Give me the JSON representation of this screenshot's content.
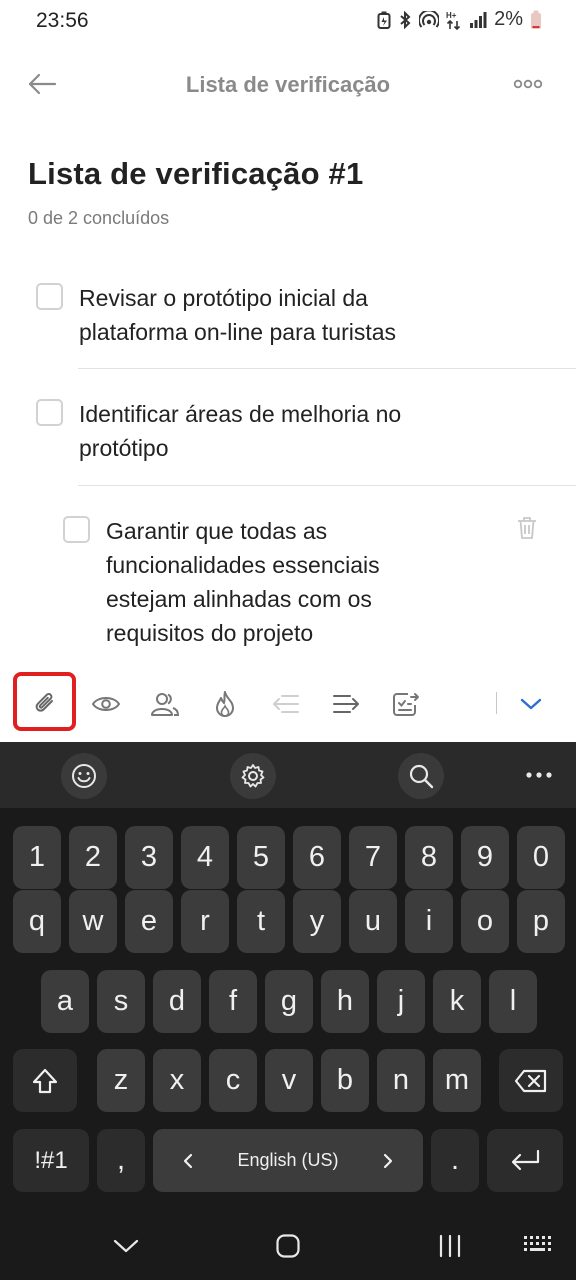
{
  "status_bar": {
    "time": "23:56",
    "battery_text": "2%",
    "icons": [
      "battery-saver-icon",
      "bluetooth-icon",
      "hotspot-icon",
      "data-arrows-icon",
      "signal-icon",
      "battery-icon"
    ]
  },
  "header": {
    "title": "Lista de verificação"
  },
  "checklist": {
    "title": "Lista de verificação #1",
    "progress": "0 de 2 concluídos",
    "items": [
      {
        "text": "Revisar o protótipo inicial da plataforma on-line para turistas",
        "checked": false
      },
      {
        "text": "Identificar áreas de melhoria no protótipo",
        "checked": false
      },
      {
        "text": "Garantir que todas as funcionalidades essenciais estejam alinhadas com os requisitos do projeto",
        "checked": false
      }
    ]
  },
  "toolbar": {
    "icons": [
      "paperclip-icon",
      "eye-icon",
      "people-icon",
      "flame-icon",
      "outdent-icon",
      "indent-icon",
      "checklist-convert-icon",
      "chevron-down-icon"
    ],
    "highlight_color": "#e02020",
    "accent_color": "#2a6fd6"
  },
  "keyboard": {
    "row_numbers": [
      "1",
      "2",
      "3",
      "4",
      "5",
      "6",
      "7",
      "8",
      "9",
      "0"
    ],
    "row1": [
      "q",
      "w",
      "e",
      "r",
      "t",
      "y",
      "u",
      "i",
      "o",
      "p"
    ],
    "row2": [
      "a",
      "s",
      "d",
      "f",
      "g",
      "h",
      "j",
      "k",
      "l"
    ],
    "row3": [
      "z",
      "x",
      "c",
      "v",
      "b",
      "n",
      "m"
    ],
    "symbols_label": "!#1",
    "comma": ",",
    "space_label": "English (US)",
    "period": ".",
    "tool_icons": [
      "emoji-icon",
      "settings-icon",
      "search-icon",
      "more-icon"
    ]
  },
  "nav_bar": {
    "icons": [
      "hide-keyboard-icon",
      "home-icon",
      "recents-icon",
      "keyboard-switch-icon"
    ]
  }
}
